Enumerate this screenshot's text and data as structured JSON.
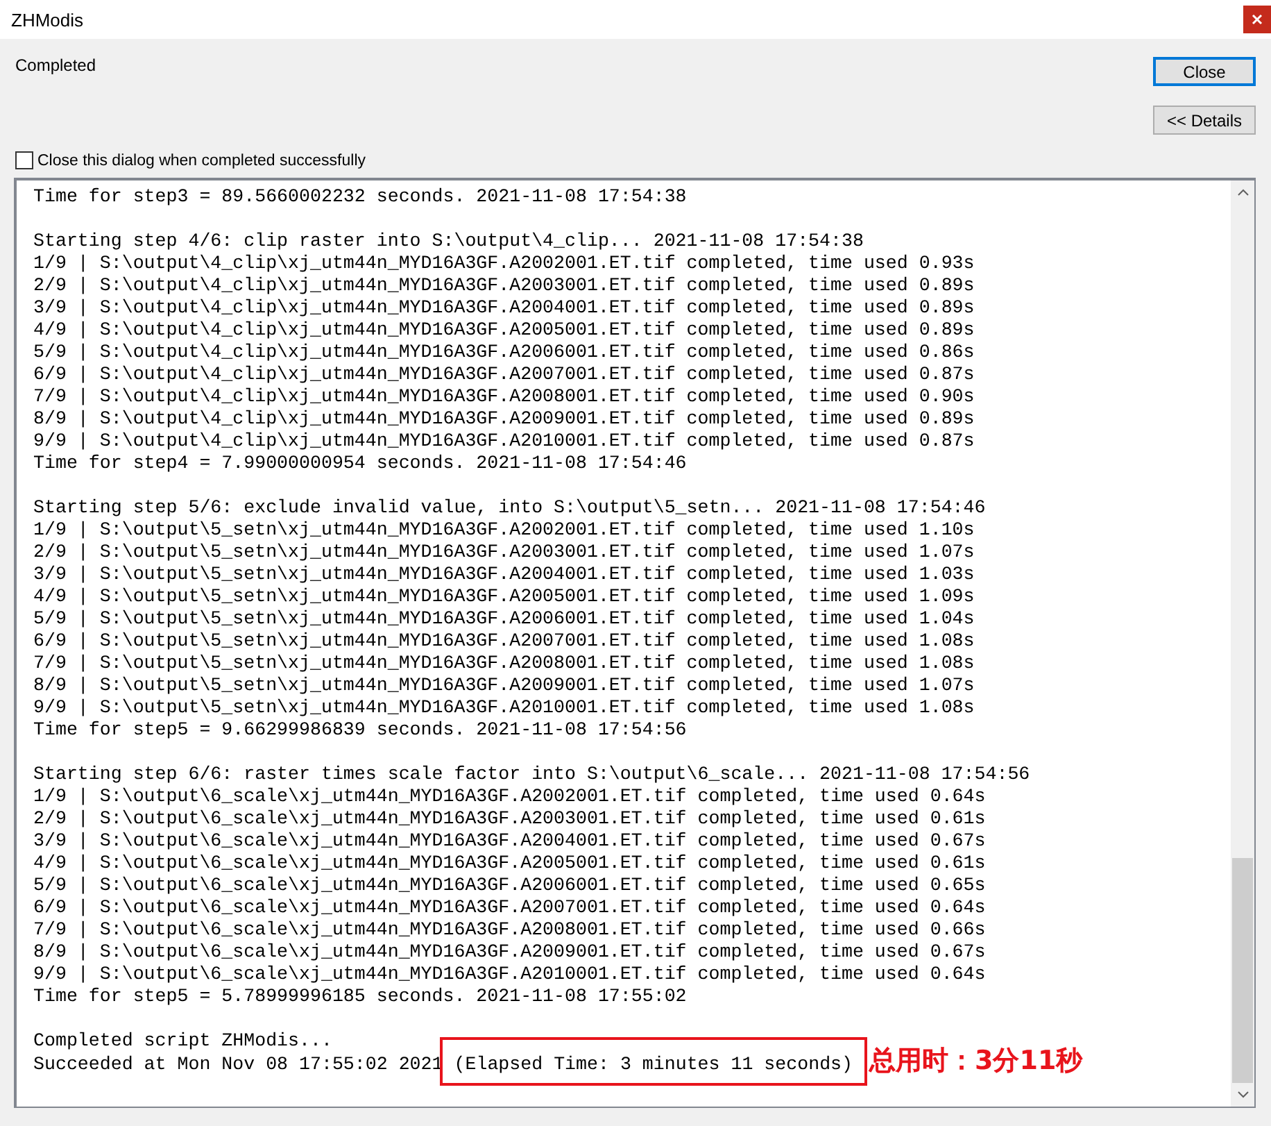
{
  "window": {
    "title": "ZHModis"
  },
  "status": "Completed",
  "buttons": [
    {
      "label": "Close",
      "focused": true
    },
    {
      "label": "<< Details",
      "focused": false
    }
  ],
  "close_on_success": {
    "label": "Close this dialog when completed successfully",
    "checked": false
  },
  "log": {
    "blocks": [
      [
        "Time for step3 = 89.5660002232 seconds. 2021-11-08 17:54:38"
      ],
      [
        "Starting step 4/6: clip raster into S:\\output\\4_clip... 2021-11-08 17:54:38",
        "1/9 | S:\\output\\4_clip\\xj_utm44n_MYD16A3GF.A2002001.ET.tif completed, time used 0.93s",
        "2/9 | S:\\output\\4_clip\\xj_utm44n_MYD16A3GF.A2003001.ET.tif completed, time used 0.89s",
        "3/9 | S:\\output\\4_clip\\xj_utm44n_MYD16A3GF.A2004001.ET.tif completed, time used 0.89s",
        "4/9 | S:\\output\\4_clip\\xj_utm44n_MYD16A3GF.A2005001.ET.tif completed, time used 0.89s",
        "5/9 | S:\\output\\4_clip\\xj_utm44n_MYD16A3GF.A2006001.ET.tif completed, time used 0.86s",
        "6/9 | S:\\output\\4_clip\\xj_utm44n_MYD16A3GF.A2007001.ET.tif completed, time used 0.87s",
        "7/9 | S:\\output\\4_clip\\xj_utm44n_MYD16A3GF.A2008001.ET.tif completed, time used 0.90s",
        "8/9 | S:\\output\\4_clip\\xj_utm44n_MYD16A3GF.A2009001.ET.tif completed, time used 0.89s",
        "9/9 | S:\\output\\4_clip\\xj_utm44n_MYD16A3GF.A2010001.ET.tif completed, time used 0.87s",
        "Time for step4 = 7.99000000954 seconds. 2021-11-08 17:54:46"
      ],
      [
        "Starting step 5/6: exclude invalid value, into S:\\output\\5_setn... 2021-11-08 17:54:46",
        "1/9 | S:\\output\\5_setn\\xj_utm44n_MYD16A3GF.A2002001.ET.tif completed, time used 1.10s",
        "2/9 | S:\\output\\5_setn\\xj_utm44n_MYD16A3GF.A2003001.ET.tif completed, time used 1.07s",
        "3/9 | S:\\output\\5_setn\\xj_utm44n_MYD16A3GF.A2004001.ET.tif completed, time used 1.03s",
        "4/9 | S:\\output\\5_setn\\xj_utm44n_MYD16A3GF.A2005001.ET.tif completed, time used 1.09s",
        "5/9 | S:\\output\\5_setn\\xj_utm44n_MYD16A3GF.A2006001.ET.tif completed, time used 1.04s",
        "6/9 | S:\\output\\5_setn\\xj_utm44n_MYD16A3GF.A2007001.ET.tif completed, time used 1.08s",
        "7/9 | S:\\output\\5_setn\\xj_utm44n_MYD16A3GF.A2008001.ET.tif completed, time used 1.08s",
        "8/9 | S:\\output\\5_setn\\xj_utm44n_MYD16A3GF.A2009001.ET.tif completed, time used 1.07s",
        "9/9 | S:\\output\\5_setn\\xj_utm44n_MYD16A3GF.A2010001.ET.tif completed, time used 1.08s",
        "Time for step5 = 9.66299986839 seconds. 2021-11-08 17:54:56"
      ],
      [
        "Starting step 6/6: raster times scale factor into S:\\output\\6_scale... 2021-11-08 17:54:56",
        "1/9 | S:\\output\\6_scale\\xj_utm44n_MYD16A3GF.A2002001.ET.tif completed, time used 0.64s",
        "2/9 | S:\\output\\6_scale\\xj_utm44n_MYD16A3GF.A2003001.ET.tif completed, time used 0.61s",
        "3/9 | S:\\output\\6_scale\\xj_utm44n_MYD16A3GF.A2004001.ET.tif completed, time used 0.67s",
        "4/9 | S:\\output\\6_scale\\xj_utm44n_MYD16A3GF.A2005001.ET.tif completed, time used 0.61s",
        "5/9 | S:\\output\\6_scale\\xj_utm44n_MYD16A3GF.A2006001.ET.tif completed, time used 0.65s",
        "6/9 | S:\\output\\6_scale\\xj_utm44n_MYD16A3GF.A2007001.ET.tif completed, time used 0.64s",
        "7/9 | S:\\output\\6_scale\\xj_utm44n_MYD16A3GF.A2008001.ET.tif completed, time used 0.66s",
        "8/9 | S:\\output\\6_scale\\xj_utm44n_MYD16A3GF.A2009001.ET.tif completed, time used 0.67s",
        "9/9 | S:\\output\\6_scale\\xj_utm44n_MYD16A3GF.A2010001.ET.tif completed, time used 0.64s",
        "Time for step5 = 5.78999996185 seconds. 2021-11-08 17:55:02"
      ]
    ],
    "summary": {
      "lines": [
        "Completed script ZHModis..."
      ],
      "last_line": "Succeeded at Mon Nov 08 17:55:02 2021",
      "highlight": "(Elapsed Time: 3 minutes 11 seconds)"
    }
  },
  "annotation": "总用时：3分11秒"
}
